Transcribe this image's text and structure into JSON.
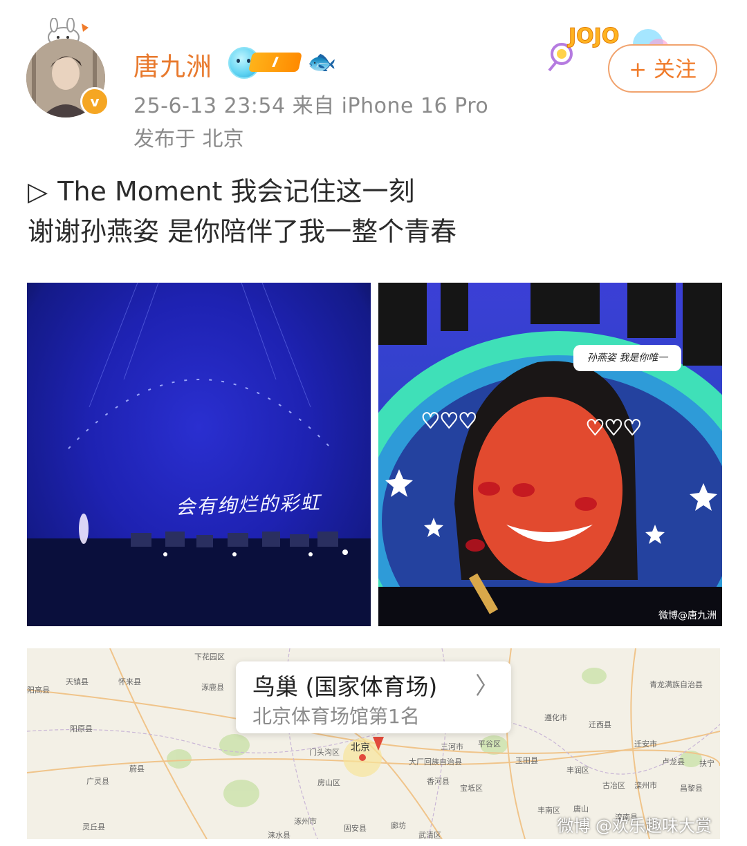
{
  "header": {
    "username": "唐九洲",
    "level_badge": "I",
    "timestamp_device": "25-6-13 23:54  来自 iPhone 16 Pro",
    "location": "发布于 北京",
    "follow_label": "+ 关注",
    "verified_mark": "v"
  },
  "post": {
    "play_icon": "▷",
    "line1": "The Moment 我会记住这一刻",
    "line2": "谢谢孙燕姿 是你陪伴了我一整个青春"
  },
  "images": [
    {
      "handwritten_text": "会有绚烂的彩虹"
    },
    {
      "bubble_text": "孙燕姿 我是你唯一",
      "watermark": "微博@唐九洲"
    }
  ],
  "map": {
    "place_name": "鸟巢 (国家体育场)",
    "chevron": "〉",
    "subtitle": "北京体育场馆第1名",
    "city_label": "北京",
    "labels": [
      "下花园区",
      "怀来县",
      "涿鹿县",
      "阳原县",
      "蔚县",
      "广灵县",
      "灵丘县",
      "门头沟区",
      "房山区",
      "涿州市",
      "涞水县",
      "固安县",
      "廊坊",
      "大厂回族自治县",
      "香河县",
      "三河市",
      "平谷区",
      "宝坻区",
      "玉田县",
      "遵化市",
      "迁西县",
      "迁安市",
      "卢龙县",
      "丰润区",
      "唐山",
      "古冶区",
      "滦州市",
      "昌黎县",
      "丰南区",
      "滦南县",
      "青龙满族自治县",
      "天镇县",
      "阳高县",
      "武清区",
      "扶宁"
    ],
    "footer_watermark": "微博 @欢乐趣味大赏"
  },
  "colors": {
    "username": "#e8792d",
    "follow_accent": "#f07b2a",
    "meta_gray": "#8b8b8b"
  }
}
